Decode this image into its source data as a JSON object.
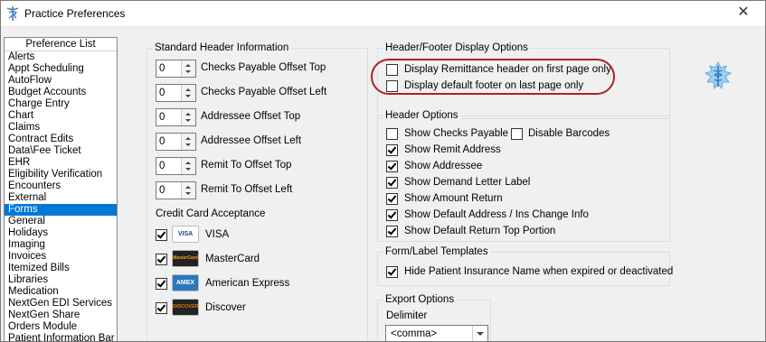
{
  "window": {
    "title": "Practice Preferences",
    "close_glyph": "✕"
  },
  "preference_list": {
    "header": "Preference List",
    "items": [
      "Alerts",
      "Appt Scheduling",
      "AutoFlow",
      "Budget Accounts",
      "Charge Entry",
      "Chart",
      "Claims",
      "Contract Edits",
      "Data\\Fee Ticket",
      "EHR",
      "Eligibility Verification",
      "Encounters",
      "External",
      "Forms",
      "General",
      "Holidays",
      "Imaging",
      "Invoices",
      "Itemized Bills",
      "Libraries",
      "Medication",
      "NextGen EDI Services",
      "NextGen Share",
      "Orders Module",
      "Patient Information Bar"
    ],
    "selected": "Forms"
  },
  "standard_header": {
    "legend": "Standard Header Information",
    "fields": [
      {
        "value": "0",
        "label": "Checks Payable Offset Top"
      },
      {
        "value": "0",
        "label": "Checks Payable Offset Left"
      },
      {
        "value": "0",
        "label": "Addressee Offset Top"
      },
      {
        "value": "0",
        "label": "Addressee Offset Left"
      },
      {
        "value": "0",
        "label": "Remit To Offset Top"
      },
      {
        "value": "0",
        "label": "Remit To Offset Left"
      }
    ]
  },
  "credit_cards": {
    "title": "Credit Card Acceptance",
    "items": [
      {
        "label": "VISA",
        "logo": "VISA",
        "checked": true,
        "color": "#1a3e8c"
      },
      {
        "label": "MasterCard",
        "logo": "MasterCard",
        "checked": true,
        "color": "#d9261c"
      },
      {
        "label": "American Express",
        "logo": "AMEX",
        "checked": true,
        "color": "#2e77bb"
      },
      {
        "label": "Discover",
        "logo": "DISCOVER",
        "checked": true,
        "color": "#e07b10"
      }
    ]
  },
  "header_footer_display": {
    "legend": "Header/Footer Display Options",
    "options": [
      {
        "label": "Display Remittance header on first page only",
        "checked": false
      },
      {
        "label": "Display default footer on last page only",
        "checked": false
      }
    ],
    "highlight_color": "#b21f24"
  },
  "header_options": {
    "legend": "Header Options",
    "options": [
      {
        "label": "Show Checks Payable",
        "checked": false
      },
      {
        "label": "Disable Barcodes",
        "checked": false
      },
      {
        "label": "Show Remit Address",
        "checked": true
      },
      {
        "label": "Show Addressee",
        "checked": true
      },
      {
        "label": "Show Demand Letter Label",
        "checked": true
      },
      {
        "label": "Show Amount Return",
        "checked": true
      },
      {
        "label": "Show Default Address / Ins Change Info",
        "checked": true
      },
      {
        "label": "Show Default Return Top Portion",
        "checked": true
      }
    ]
  },
  "form_label_templates": {
    "legend": "Form/Label Templates",
    "options": [
      {
        "label": "Hide Patient Insurance Name when expired or deactivated",
        "checked": true
      }
    ]
  },
  "export_options": {
    "legend": "Export Options",
    "delimiter_label": "Delimiter",
    "delimiter_value": "<comma>"
  },
  "icons": {
    "app": "caduceus-icon",
    "brand": "caduceus-logo-icon"
  }
}
